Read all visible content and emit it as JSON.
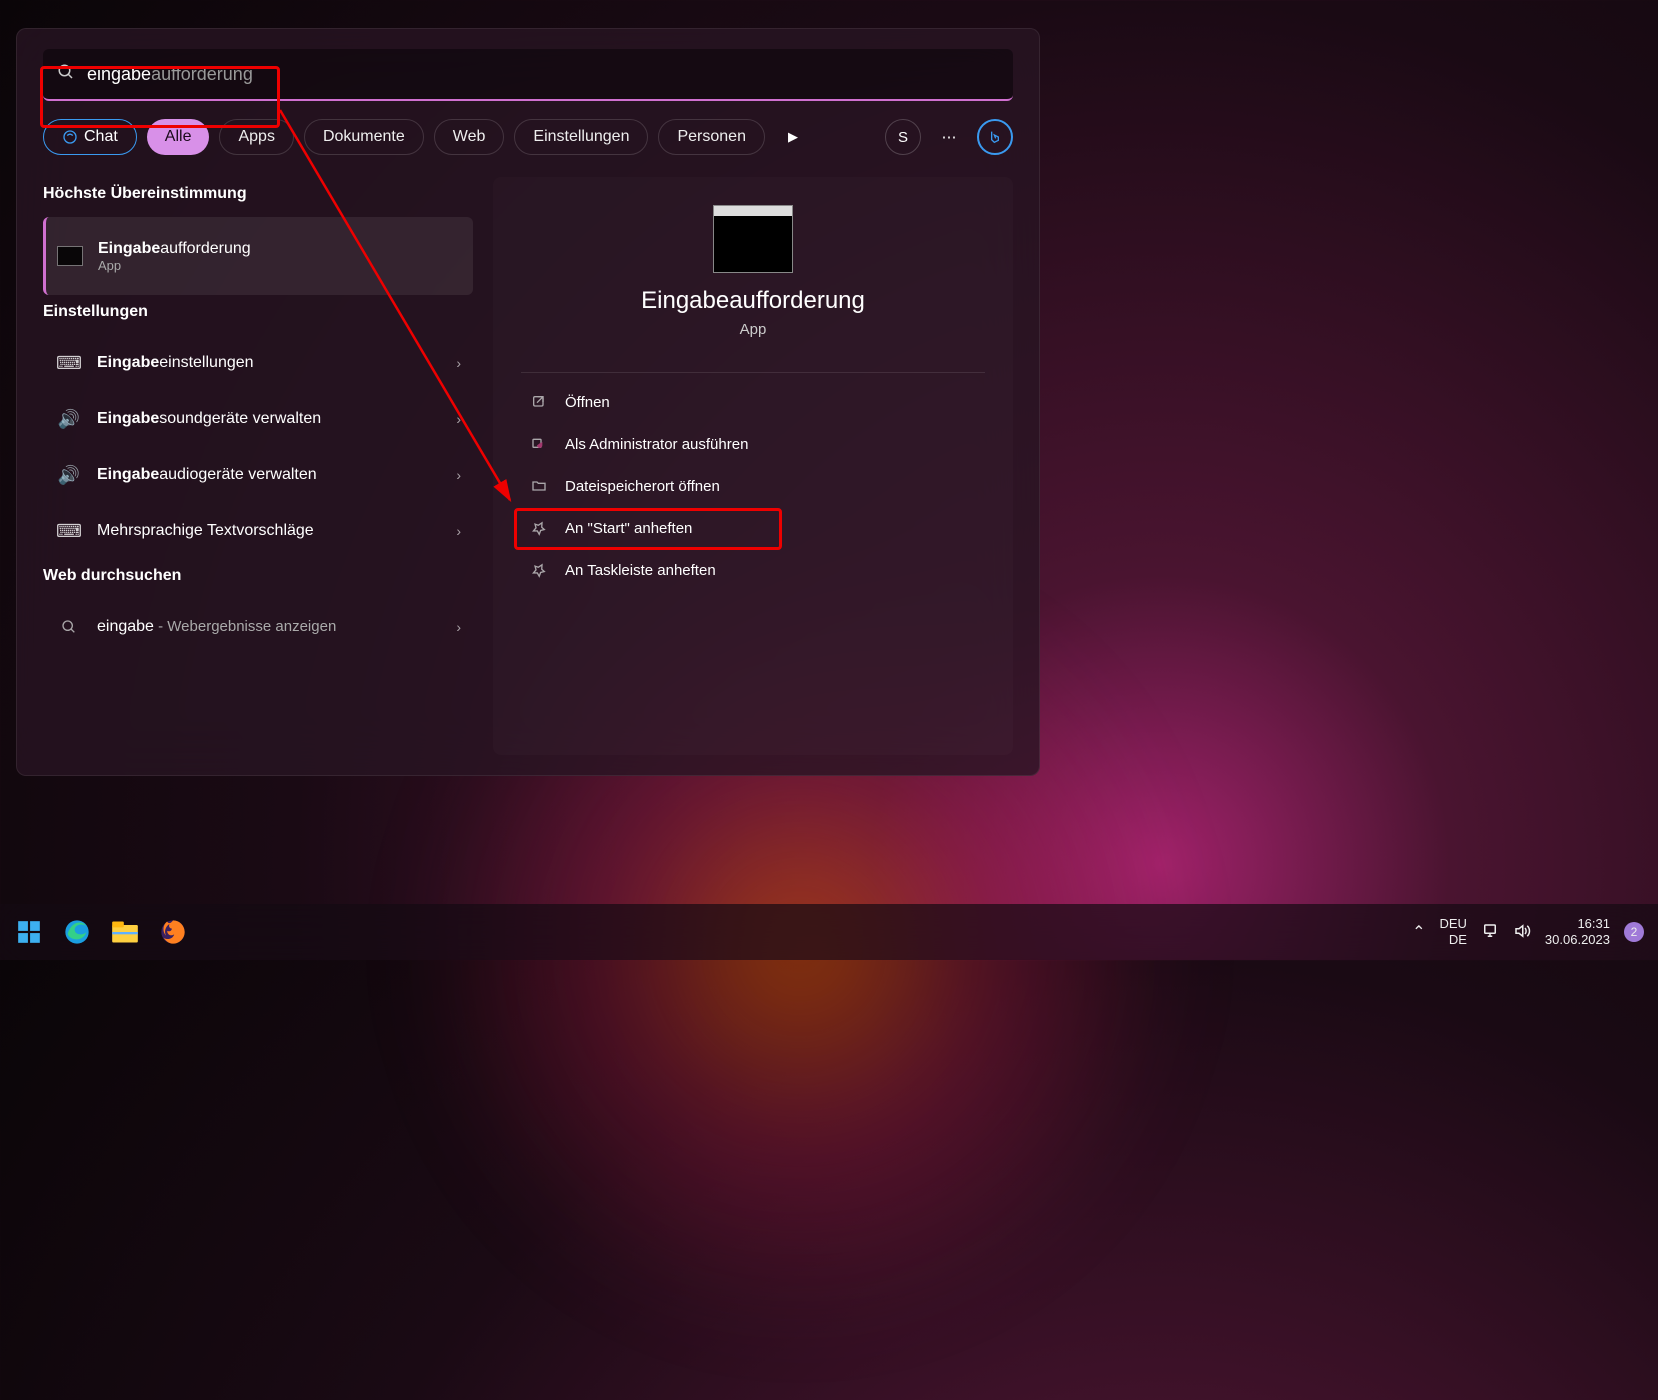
{
  "search": {
    "typed": "eingabe",
    "suggestion_rest": "aufforderung"
  },
  "filters": {
    "chat": "Chat",
    "all": "Alle",
    "apps": "Apps",
    "documents": "Dokumente",
    "web": "Web",
    "settings": "Einstellungen",
    "people": "Personen",
    "user_initial": "S"
  },
  "results": {
    "best_match_header": "Höchste Übereinstimmung",
    "best_match": {
      "title_bold": "Eingabe",
      "title_rest": "aufforderung",
      "subtitle": "App"
    },
    "settings_header": "Einstellungen",
    "settings_items": [
      {
        "bold": "Eingabe",
        "rest": "einstellungen",
        "icon": "keyboard"
      },
      {
        "bold": "Eingabe",
        "rest": "soundgeräte verwalten",
        "icon": "sound"
      },
      {
        "bold": "Eingabe",
        "rest": "audiogeräte verwalten",
        "icon": "sound"
      },
      {
        "bold": "",
        "rest": "Mehrsprachige Textvorschläge",
        "icon": "keyboard"
      }
    ],
    "web_header": "Web durchsuchen",
    "web_item": {
      "term": "eingabe",
      "hint": " - Webergebnisse anzeigen"
    }
  },
  "detail": {
    "title": "Eingabeaufforderung",
    "subtitle": "App",
    "actions": [
      {
        "icon": "open",
        "label": "Öffnen"
      },
      {
        "icon": "admin",
        "label": "Als Administrator ausführen",
        "highlighted": true
      },
      {
        "icon": "folder",
        "label": "Dateispeicherort öffnen"
      },
      {
        "icon": "pin",
        "label": "An \"Start\" anheften"
      },
      {
        "icon": "pin",
        "label": "An Taskleiste anheften"
      }
    ]
  },
  "taskbar": {
    "language_top": "DEU",
    "language_bottom": "DE",
    "time": "16:31",
    "date": "30.06.2023",
    "notification_count": "2"
  }
}
